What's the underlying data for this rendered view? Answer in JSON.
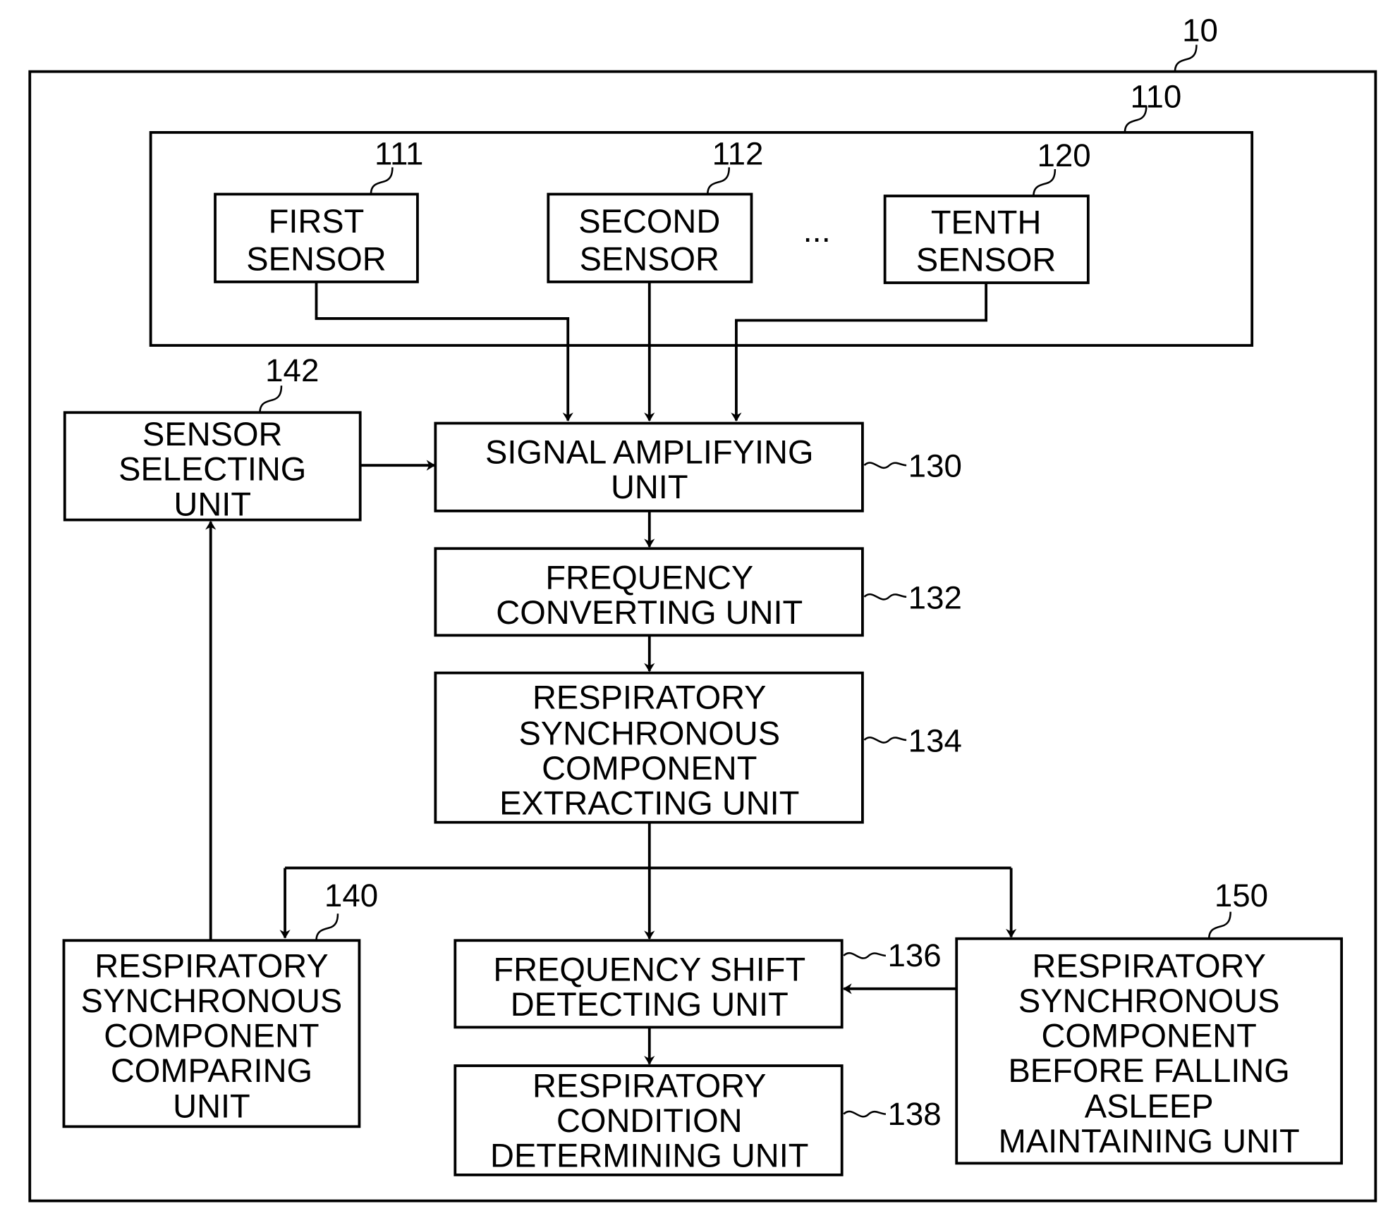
{
  "figure": {
    "ref_device": "10",
    "ref_sensor_group": "110",
    "ellipsis": "...",
    "blocks": {
      "first_sensor": {
        "ref": "111",
        "lines": [
          "FIRST",
          "SENSOR"
        ]
      },
      "second_sensor": {
        "ref": "112",
        "lines": [
          "SECOND",
          "SENSOR"
        ]
      },
      "tenth_sensor": {
        "ref": "120",
        "lines": [
          "TENTH",
          "SENSOR"
        ]
      },
      "sensor_selecting": {
        "ref": "142",
        "lines": [
          "SENSOR",
          "SELECTING",
          "UNIT"
        ]
      },
      "signal_amplifying": {
        "ref": "130",
        "lines": [
          "SIGNAL AMPLIFYING",
          "UNIT"
        ]
      },
      "frequency_converting": {
        "ref": "132",
        "lines": [
          "FREQUENCY",
          "CONVERTING UNIT"
        ]
      },
      "rsc_extracting": {
        "ref": "134",
        "lines": [
          "RESPIRATORY",
          "SYNCHRONOUS",
          "COMPONENT",
          "EXTRACTING UNIT"
        ]
      },
      "rsc_comparing": {
        "ref": "140",
        "lines": [
          "RESPIRATORY",
          "SYNCHRONOUS",
          "COMPONENT",
          "COMPARING",
          "UNIT"
        ]
      },
      "frequency_shift": {
        "ref": "136",
        "lines": [
          "FREQUENCY SHIFT",
          "DETECTING UNIT"
        ]
      },
      "respiratory_condition": {
        "ref": "138",
        "lines": [
          "RESPIRATORY",
          "CONDITION",
          "DETERMINING UNIT"
        ]
      },
      "rsc_before_sleep": {
        "ref": "150",
        "lines": [
          "RESPIRATORY",
          "SYNCHRONOUS",
          "COMPONENT",
          "BEFORE FALLING",
          "ASLEEP",
          "MAINTAINING UNIT"
        ]
      }
    }
  }
}
